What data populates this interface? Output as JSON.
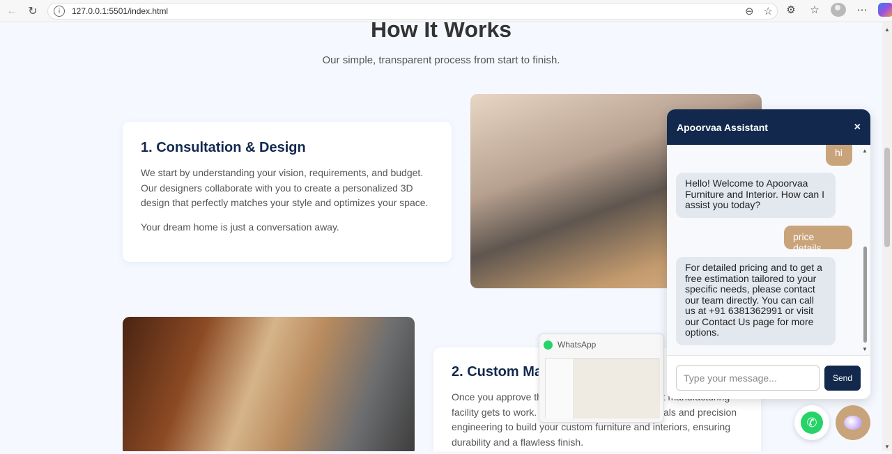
{
  "browser": {
    "url": "127.0.0.1:5501/index.html"
  },
  "section": {
    "title": "How It Works",
    "subtitle": "Our simple, transparent process from start to finish."
  },
  "steps": [
    {
      "title": "1. Consultation & Design",
      "paragraphs": [
        "We start by understanding your vision, requirements, and budget. Our designers collaborate with you to create a personalized 3D design that perfectly matches your style and optimizes your space.",
        "Your dream home is just a conversation away."
      ]
    },
    {
      "title": "2. Custom Manufacturing",
      "paragraphs": [
        "Once you approve the design, our state-of-the-art manufacturing facility gets to work. We use only premium materials and precision engineering to build your custom furniture and interiors, ensuring durability and a flawless finish."
      ]
    }
  ],
  "whatsapp_preview": {
    "title": "WhatsApp"
  },
  "chat": {
    "title": "Apoorvaa Assistant",
    "close_glyph": "×",
    "messages": [
      {
        "from": "user",
        "text": "hi"
      },
      {
        "from": "bot",
        "text": "Hello! Welcome to Apoorvaa Furniture and Interior. How can I assist you today?"
      },
      {
        "from": "user",
        "text": "price details"
      },
      {
        "from": "bot",
        "text": "For detailed pricing and to get a free estimation tailored to your specific needs, please contact our team directly. You can call us at +91 6381362991 or visit our Contact Us page for more options."
      }
    ],
    "input_placeholder": "Type your message...",
    "send_label": "Send"
  },
  "colors": {
    "navy": "#12294d",
    "accent": "#c9a47a",
    "whatsapp": "#25d366"
  },
  "icons": {
    "back": "back-arrow-icon",
    "reload": "reload-icon",
    "info": "site-info-icon",
    "whatsapp": "whatsapp-icon",
    "chat": "chat-bubble-icon"
  }
}
